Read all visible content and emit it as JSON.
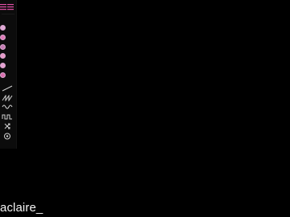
{
  "toolbar": {
    "logo_icon": "logo-icon",
    "accent_color": "#e14fa6",
    "palette": [
      {
        "name": "color-swatch-1-icon",
        "color": "#e0a9d6"
      },
      {
        "name": "color-swatch-2-icon",
        "color": "#e07ab7"
      },
      {
        "name": "color-swatch-3-icon",
        "color": "#c77db4"
      },
      {
        "name": "color-swatch-4-icon",
        "color": "#e89ac8"
      },
      {
        "name": "color-swatch-5-icon",
        "color": "#e6a1d1"
      },
      {
        "name": "color-swatch-6-icon",
        "color": "#d96fae"
      }
    ],
    "tools": [
      {
        "name": "ramp-wave-icon"
      },
      {
        "name": "sawtooth-wave-icon"
      },
      {
        "name": "sine-wave-icon"
      },
      {
        "name": "square-wave-icon"
      },
      {
        "name": "shuffle-icon"
      },
      {
        "name": "settings-icon"
      }
    ]
  },
  "user": {
    "username": "aclaire_"
  }
}
